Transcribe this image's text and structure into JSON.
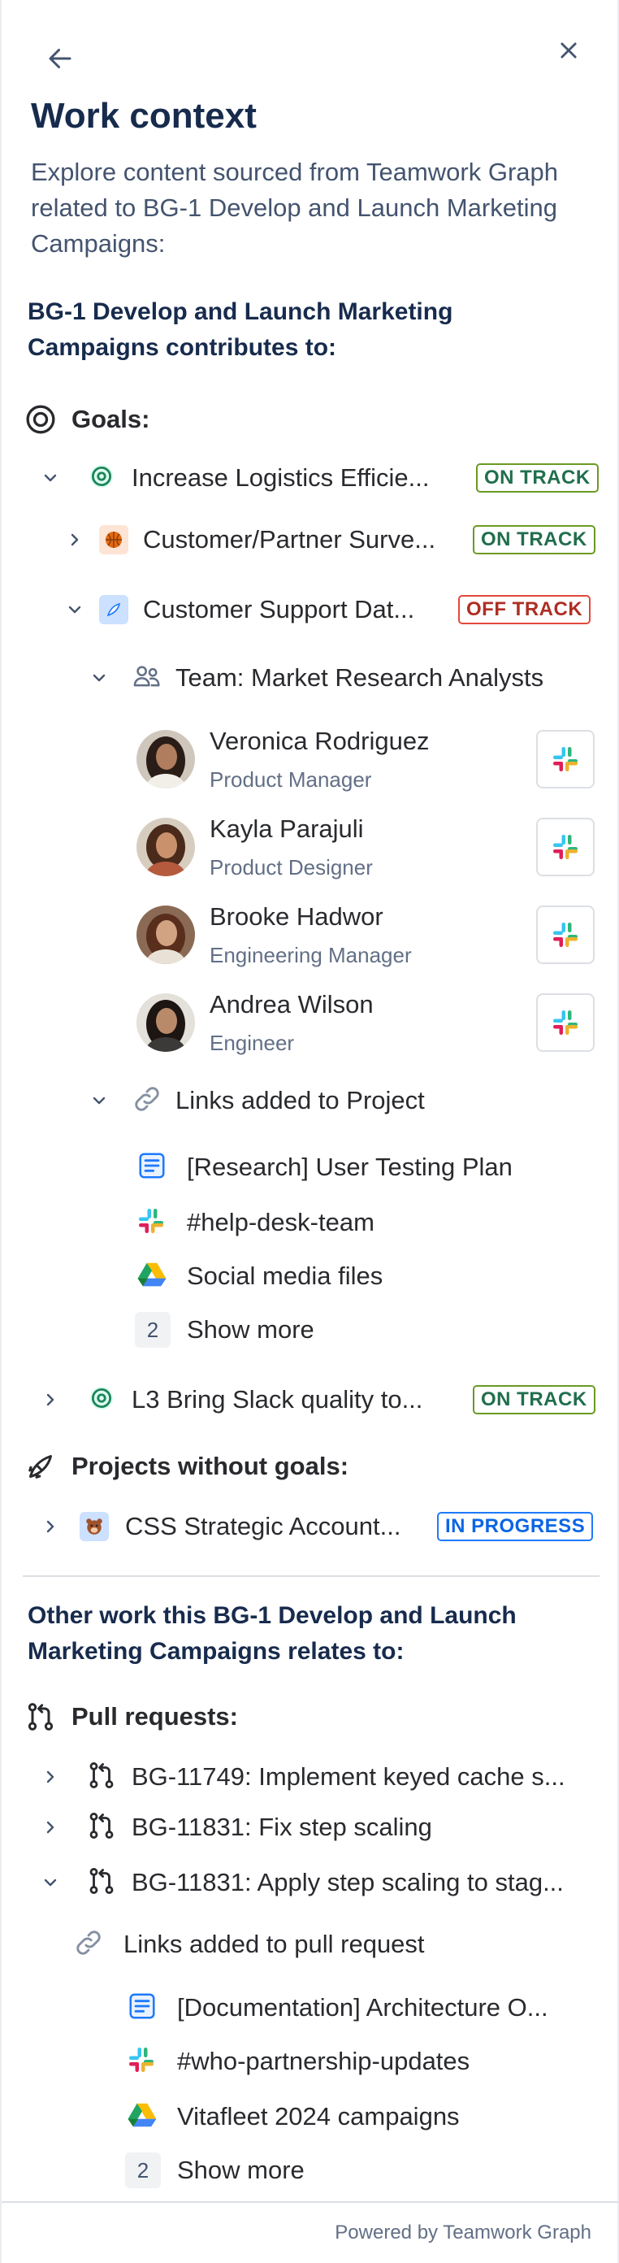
{
  "header": {
    "back_icon": "arrow-left-icon",
    "close_icon": "close-icon",
    "title": "Work context",
    "intro": "Explore content sourced from Teamwork Graph related to BG-1 Develop and Launch Marketing Campaigns:"
  },
  "contributes": {
    "heading": "BG-1 Develop and Launch Marketing Campaigns contributes to:",
    "goals_label": "Goals:",
    "goal1": {
      "label": "Increase Logistics Efficie...",
      "status": "ON TRACK"
    },
    "project1": {
      "label": "Customer/Partner Surve...",
      "status": "ON TRACK"
    },
    "project2": {
      "label": "Customer Support Dat...",
      "status": "OFF TRACK"
    },
    "team_label": "Team: Market Research Analysts",
    "people": [
      {
        "name": "Veronica Rodriguez",
        "role": "Product Manager"
      },
      {
        "name": "Kayla Parajuli",
        "role": "Product Designer"
      },
      {
        "name": "Brooke Hadwor",
        "role": "Engineering Manager"
      },
      {
        "name": "Andrea Wilson",
        "role": "Engineer"
      }
    ],
    "links_label": "Links added to Project",
    "links": [
      {
        "label": "[Research] User Testing Plan",
        "icon": "doc-icon"
      },
      {
        "label": "#help-desk-team",
        "icon": "slack-icon"
      },
      {
        "label": "Social media files",
        "icon": "google-drive-icon"
      }
    ],
    "show_more_count": "2",
    "show_more_label": "Show more",
    "goal2": {
      "label": "L3 Bring Slack quality to...",
      "status": "ON TRACK"
    },
    "projects_without_goals_label": "Projects without goals:",
    "project3": {
      "label": "CSS Strategic Account...",
      "status": "IN PROGRESS"
    }
  },
  "other": {
    "heading": "Other work this BG-1 Develop and Launch Marketing Campaigns relates to:",
    "pr_label": "Pull requests:",
    "prs": [
      "BG-11749: Implement keyed cache s...",
      "BG-11831: Fix step scaling",
      "BG-11831: Apply step scaling to stag..."
    ],
    "links_label": "Links added to pull request",
    "links": [
      {
        "label": "[Documentation] Architecture O...",
        "icon": "doc-icon"
      },
      {
        "label": "#who-partnership-updates",
        "icon": "slack-icon"
      },
      {
        "label": "Vitafleet 2024 campaigns",
        "icon": "google-drive-icon"
      }
    ],
    "show_more_count": "2",
    "show_more_label": "Show more"
  },
  "footer": {
    "label": "Powered by Teamwork Graph"
  },
  "colors": {
    "on_track": "#6a9a23",
    "off_track": "#e2483d",
    "in_progress": "#1d7afc"
  }
}
